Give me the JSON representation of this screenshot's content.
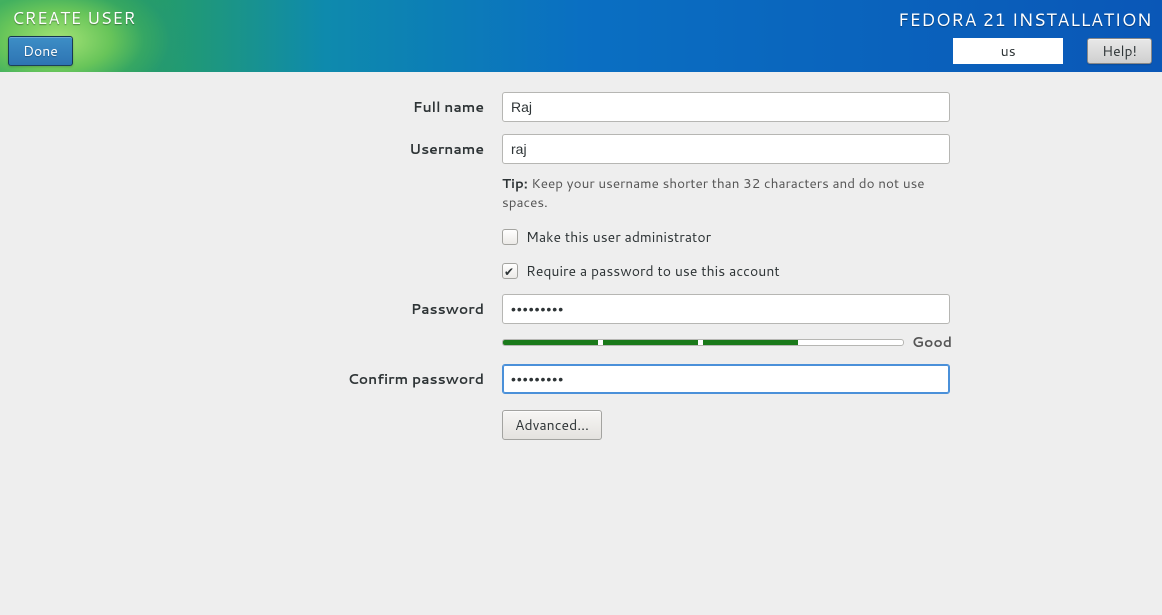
{
  "header": {
    "page_title": "CREATE USER",
    "done_label": "Done",
    "installer_title": "FEDORA 21 INSTALLATION",
    "keyboard_layout": "us",
    "help_label": "Help!"
  },
  "form": {
    "full_name_label": "Full name",
    "full_name_value": "Raj",
    "username_label": "Username",
    "username_value": "raj",
    "tip_prefix": "Tip:",
    "tip_text": "Keep your username shorter than 32 characters and do not use spaces.",
    "admin_check_label": "Make this user administrator",
    "admin_checked": false,
    "require_pw_label": "Require a password to use this account",
    "require_pw_checked": true,
    "password_label": "Password",
    "password_value": "•••••••••",
    "strength_text": "Good",
    "strength_percent": 74,
    "confirm_label": "Confirm password",
    "confirm_value": "•••••••••",
    "advanced_label": "Advanced..."
  }
}
